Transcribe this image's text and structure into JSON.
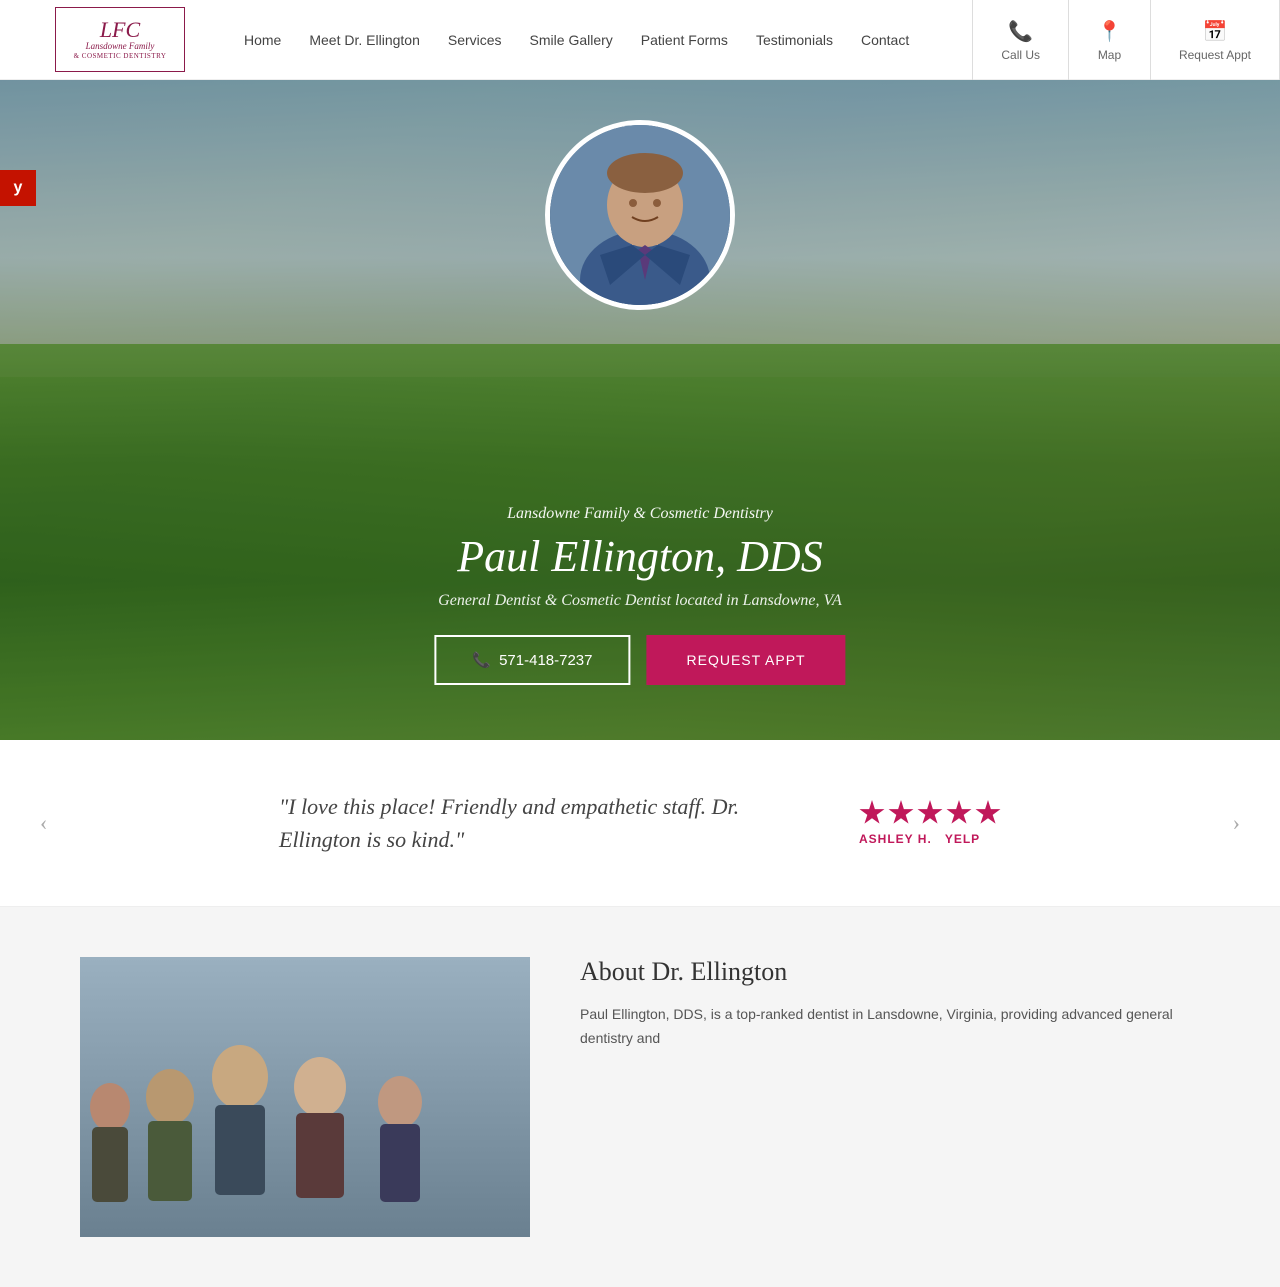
{
  "site": {
    "logo_monogram": "LFC",
    "logo_name": "Lansdowne Family",
    "logo_sub": "& COSMETIC DENTISTRY"
  },
  "nav": {
    "items": [
      {
        "label": "Home",
        "id": "home"
      },
      {
        "label": "Meet Dr. Ellington",
        "id": "meet"
      },
      {
        "label": "Services",
        "id": "services"
      },
      {
        "label": "Smile Gallery",
        "id": "gallery"
      },
      {
        "label": "Patient Forms",
        "id": "forms"
      },
      {
        "label": "Testimonials",
        "id": "testimonials"
      },
      {
        "label": "Contact",
        "id": "contact"
      }
    ]
  },
  "utility": {
    "call_label": "Call Us",
    "map_label": "Map",
    "appt_label": "Request Appt"
  },
  "hero": {
    "practice_name": "Lansdowne Family & Cosmetic Dentistry",
    "doctor_name": "Paul Ellington, DDS",
    "description": "General Dentist & Cosmetic Dentist located in Lansdowne, VA",
    "phone_btn": "571-418-7237",
    "appt_btn": "REQUEST APPT"
  },
  "testimonial": {
    "quote": "\"I love this place! Friendly and empathetic staff. Dr. Ellington is so kind.\"",
    "reviewer_name": "ASHLEY H.",
    "reviewer_source": "YELP",
    "stars": 5,
    "prev_label": "‹",
    "next_label": "›"
  },
  "about": {
    "title": "About Dr. Ellington",
    "body": "Paul Ellington, DDS, is a top-ranked dentist in Lansdowne, Virginia, providing advanced general dentistry and"
  },
  "yelp": {
    "label": "y"
  }
}
